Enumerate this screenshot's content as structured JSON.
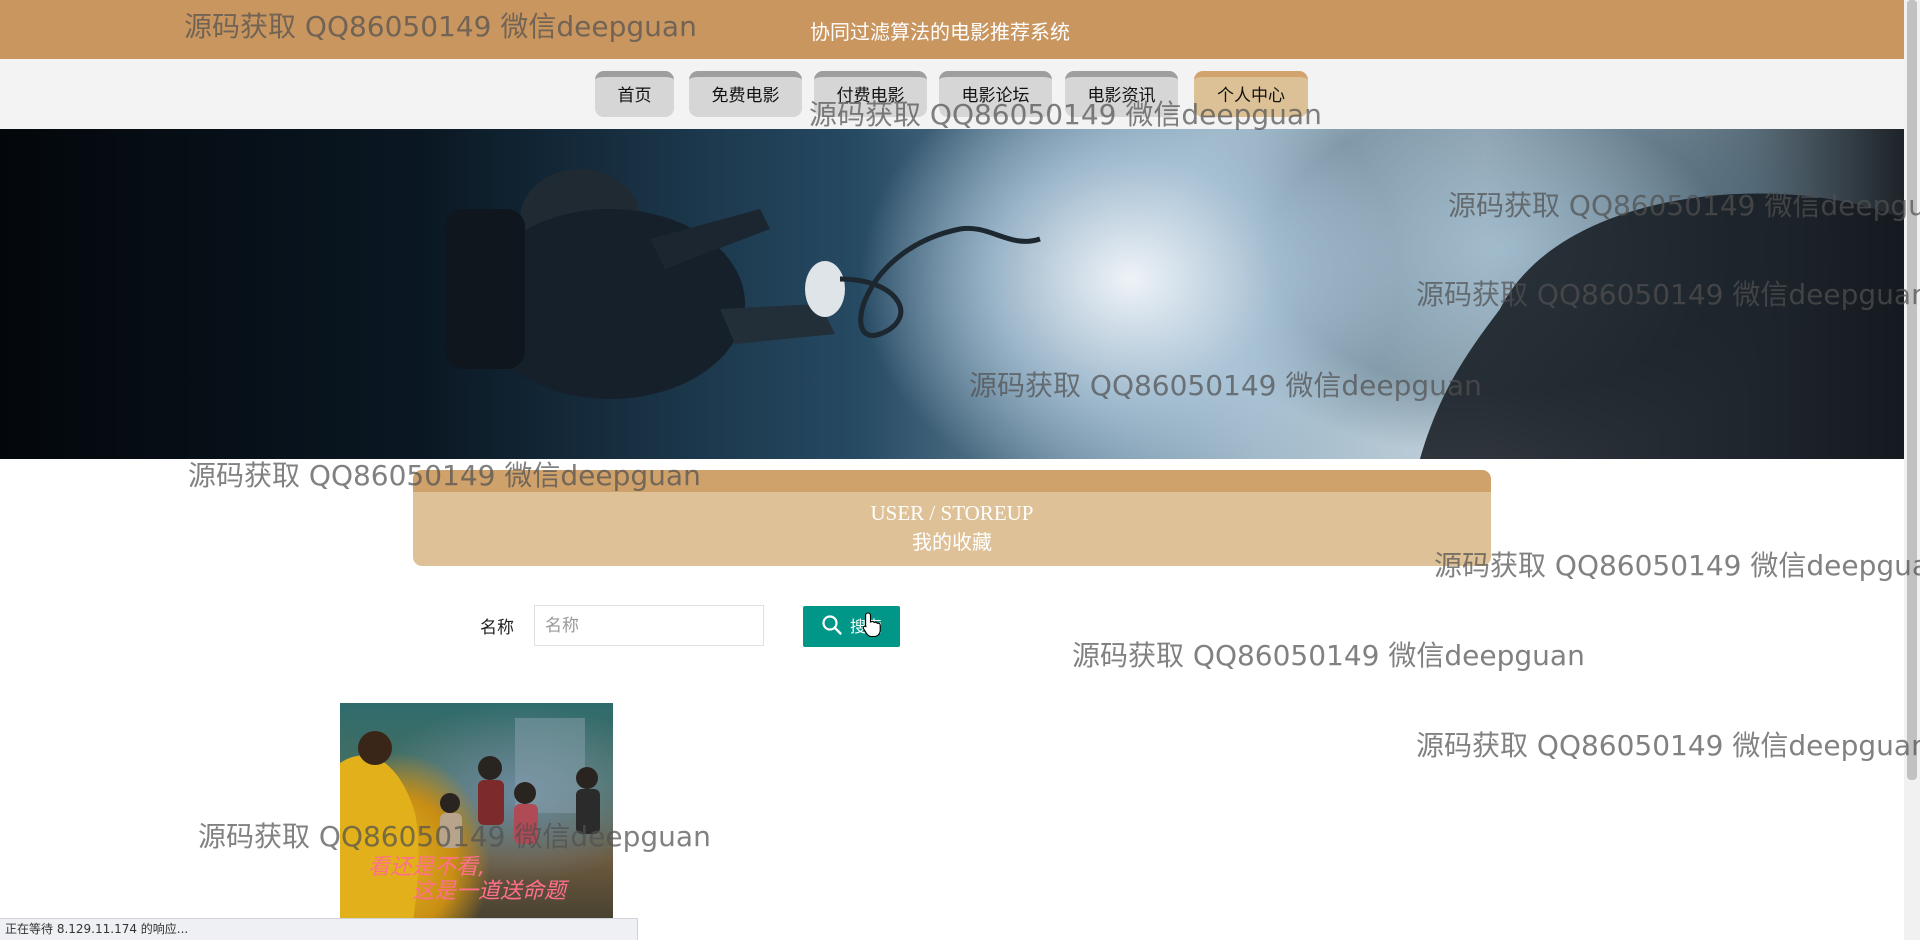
{
  "header": {
    "title": "协同过滤算法的电影推荐系统"
  },
  "nav": [
    {
      "label": "首页",
      "active": false
    },
    {
      "label": "免费电影",
      "active": false
    },
    {
      "label": "付费电影",
      "active": false
    },
    {
      "label": "电影论坛",
      "active": false
    },
    {
      "label": "电影资讯",
      "active": false
    },
    {
      "label": "个人中心",
      "active": true
    }
  ],
  "section": {
    "title_en": "USER / STOREUP",
    "title_cn": "我的收藏"
  },
  "search": {
    "label": "名称",
    "placeholder": "名称",
    "button_label": "搜索",
    "button_icon": "search-icon"
  },
  "favorites": [
    {
      "poster_text_line1": "看还是不看,",
      "poster_text_line2": "这是一道送命题"
    }
  ],
  "statusbar": {
    "text": "正在等待 8.129.11.174 的响应..."
  },
  "watermark": {
    "text": "源码获取 QQ86050149 微信deepguan"
  },
  "colors": {
    "header": "#c99660",
    "nav_active": "#dcc196",
    "section_header": "#dec197",
    "search_button": "#009688"
  }
}
